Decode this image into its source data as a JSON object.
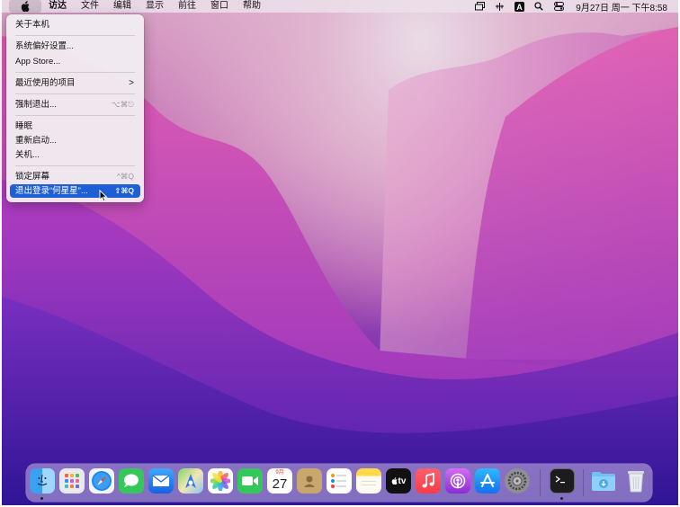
{
  "menubar": {
    "app_name": "访达",
    "menus": [
      "文件",
      "编辑",
      "显示",
      "前往",
      "窗口",
      "帮助"
    ],
    "clock": "9月27日 周一 下午8:58",
    "icons": [
      "window-icon",
      "sound-icon",
      "input-method-icon",
      "search-icon",
      "control-center-icon"
    ]
  },
  "apple_menu": {
    "items": [
      {
        "label": "关于本机",
        "shortcut": ""
      },
      {
        "label": "系统偏好设置...",
        "shortcut": ""
      },
      {
        "label": "App Store...",
        "shortcut": ""
      },
      {
        "label": "最近使用的项目",
        "shortcut": ">"
      },
      {
        "label": "强制退出...",
        "shortcut": "⌥⌘⎋"
      },
      {
        "label": "睡眠",
        "shortcut": ""
      },
      {
        "label": "重新启动...",
        "shortcut": ""
      },
      {
        "label": "关机...",
        "shortcut": ""
      },
      {
        "label": "锁定屏幕",
        "shortcut": "^⌘Q"
      },
      {
        "label": "退出登录“何星星”...",
        "shortcut": "⇧⌘Q"
      }
    ]
  },
  "dock": {
    "calendar_month": "9月",
    "calendar_day": "27",
    "tv_label": "tv",
    "apps": [
      "finder",
      "launchpad",
      "safari",
      "messages",
      "mail",
      "maps",
      "photos",
      "facetime",
      "calendar",
      "contacts",
      "reminders",
      "notes",
      "tv",
      "music",
      "podcasts",
      "app-store",
      "system-preferences",
      "terminal",
      "downloads",
      "trash"
    ]
  },
  "colors": {
    "selection": "#1e5fd6",
    "wall_top": "#e0b4cf",
    "wall_bottom": "#3d18a0"
  }
}
